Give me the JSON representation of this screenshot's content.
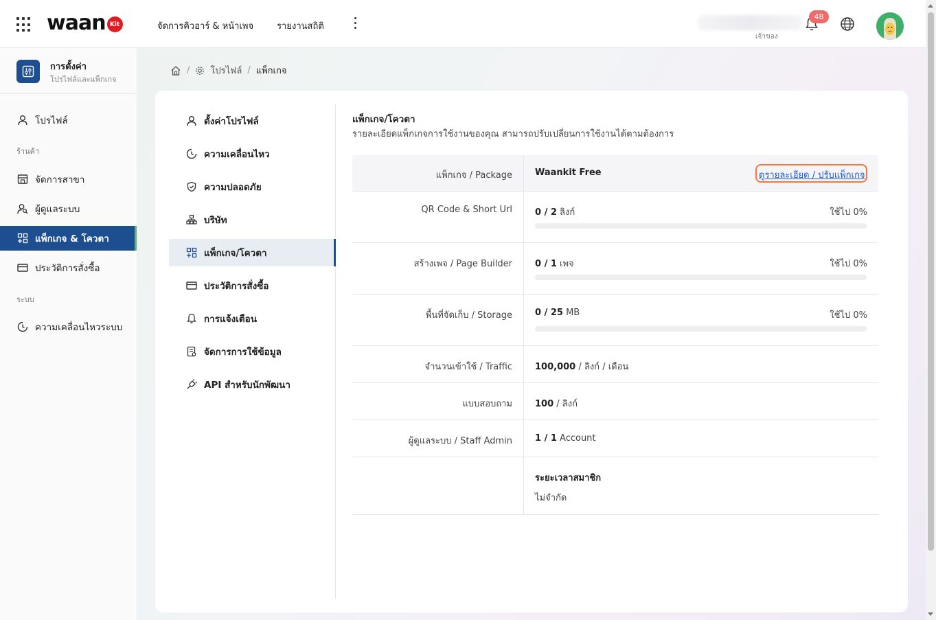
{
  "header": {
    "logo_text": "waan",
    "logo_badge": "Kit",
    "nav": [
      "จัดการคิวอาร์ & หน้าเพจ",
      "รายงานสถิติ"
    ],
    "user_role": "เจ้าของ",
    "notification_count": "48",
    "icons": [
      "apps-grid-icon",
      "more-vertical-icon",
      "bell-icon",
      "globe-icon"
    ]
  },
  "sidebar": {
    "title": "การตั้งค่า",
    "subtitle": "โปรไฟล์และแพ็กเกจ",
    "items": [
      {
        "label": "โปรไฟล์",
        "icon": "user-icon"
      },
      {
        "label": "จัดการสาขา",
        "icon": "store-icon"
      },
      {
        "label": "ผู้ดูแลระบบ",
        "icon": "user-search-icon"
      },
      {
        "label": "แพ็กเกจ & โควตา",
        "icon": "package-grid-icon",
        "active": true
      },
      {
        "label": "ประวัติการสั่งซื้อ",
        "icon": "card-icon"
      },
      {
        "label": "ความเคลื่อนไหวระบบ",
        "icon": "clock-icon"
      }
    ],
    "groups": [
      "ร้านค้า",
      "ระบบ"
    ]
  },
  "breadcrumb": {
    "items": [
      "โปรไฟล์",
      "แพ็กเกจ"
    ]
  },
  "subnav": {
    "items": [
      {
        "label": "ตั้งค่าโปรไฟล์",
        "icon": "user-icon"
      },
      {
        "label": "ความเคลื่อนไหว",
        "icon": "clock-icon"
      },
      {
        "label": "ความปลอดภัย",
        "icon": "shield-icon"
      },
      {
        "label": "บริษัท",
        "icon": "org-chart-icon"
      },
      {
        "label": "แพ็กเกจ/โควตา",
        "icon": "package-grid-icon",
        "active": true
      },
      {
        "label": "ประวัติการสั่งซื้อ",
        "icon": "card-icon"
      },
      {
        "label": "การแจ้งเตือน",
        "icon": "bell-icon"
      },
      {
        "label": "จัดการการใช้ข้อมูล",
        "icon": "data-document-icon"
      },
      {
        "label": "API สำหรับนักพัฒนา",
        "icon": "plug-icon"
      }
    ]
  },
  "content": {
    "title": "แพ็กเกจ/โควตา",
    "description": "รายละเอียดแพ็กเกจการใช้งานของคุณ สามารถปรับเปลี่ยนการใช้งานได้ตามต้องการ",
    "detail_link": "ดูรายละเอียด / ปรับแพ็กเกจ",
    "package_label": "แพ็กเกจ / Package",
    "package_value": "Waankit Free",
    "quotas": [
      {
        "label": "QR Code & Short Url",
        "used": "0",
        "limit": "2",
        "unit": "ลิงก์",
        "usage_text": "ใช้ไป 0%",
        "usage_percent": 0
      },
      {
        "label": "สร้างเพจ / Page Builder",
        "used": "0",
        "limit": "1",
        "unit": "เพจ",
        "usage_text": "ใช้ไป 0%",
        "usage_percent": 0
      },
      {
        "label": "พื้นที่จัดเก็บ / Storage",
        "used": "0",
        "limit": "25",
        "unit": "MB",
        "usage_text": "ใช้ไป 0%",
        "usage_percent": 0
      }
    ],
    "traffic": {
      "label": "จำนวนเข้าใช้ / Traffic",
      "value": "100,000",
      "unit": "/ ลิงก์ / เดือน"
    },
    "survey": {
      "label": "แบบสอบถาม",
      "value": "100",
      "unit": "/ ลิงก์"
    },
    "staff": {
      "label": "ผู้ดูแลระบบ / Staff Admin",
      "value": "1 / 1",
      "unit": "Account"
    },
    "membership": {
      "title": "ระยะเวลาสมาชิก",
      "value": "ไม่จำกัด"
    }
  },
  "colors": {
    "primary": "#1d4e8f",
    "link": "#1d5bd6",
    "highlight_border": "#f07a3e",
    "badge": "#f06a6a",
    "active_indicator": "#61b27b"
  }
}
